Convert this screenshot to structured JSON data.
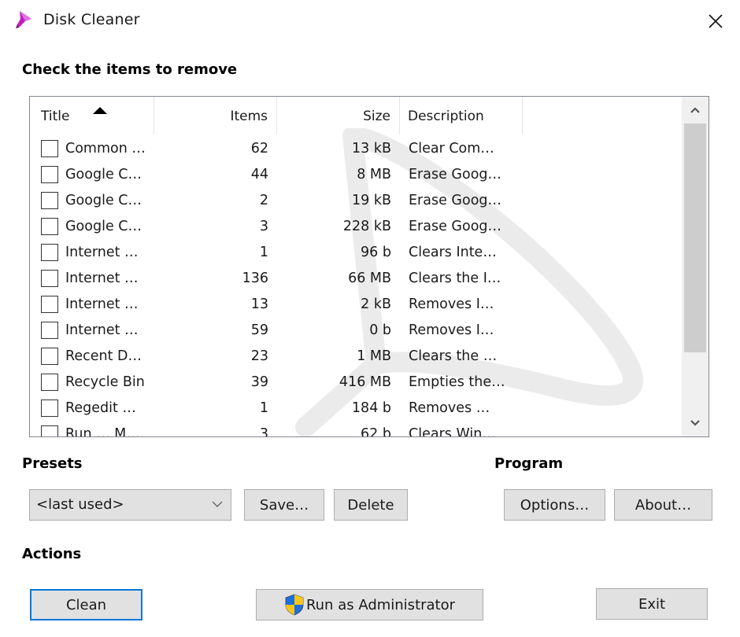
{
  "window": {
    "title": "Disk Cleaner",
    "app_icon": "funnel-icon",
    "close_icon": "close-icon"
  },
  "list_section": {
    "heading": "Check the items to remove",
    "columns": [
      {
        "label": "Title",
        "sorted": "ascending"
      },
      {
        "label": "Items"
      },
      {
        "label": "Size"
      },
      {
        "label": "Description"
      }
    ],
    "rows": [
      {
        "title": "Common …",
        "items": "62",
        "size": "13 kB",
        "description": "Clear Com…",
        "checked": false
      },
      {
        "title": "Google C…",
        "items": "44",
        "size": "8 MB",
        "description": "Erase Goog…",
        "checked": false
      },
      {
        "title": "Google C…",
        "items": "2",
        "size": "19 kB",
        "description": "Erase Goog…",
        "checked": false
      },
      {
        "title": "Google C…",
        "items": "3",
        "size": "228 kB",
        "description": "Erase Goog…",
        "checked": false
      },
      {
        "title": "Internet …",
        "items": "1",
        "size": "96 b",
        "description": "Clears Inte…",
        "checked": false
      },
      {
        "title": "Internet …",
        "items": "136",
        "size": "66 MB",
        "description": "Clears the I…",
        "checked": false
      },
      {
        "title": "Internet …",
        "items": "13",
        "size": "2 kB",
        "description": "Removes I…",
        "checked": false
      },
      {
        "title": "Internet …",
        "items": "59",
        "size": "0 b",
        "description": "Removes I…",
        "checked": false
      },
      {
        "title": "Recent D…",
        "items": "23",
        "size": "1 MB",
        "description": "Clears the …",
        "checked": false
      },
      {
        "title": "Recycle Bin",
        "items": "39",
        "size": "416 MB",
        "description": "Empties the…",
        "checked": false
      },
      {
        "title": "Regedit …",
        "items": "1",
        "size": "184 b",
        "description": "Removes …",
        "checked": false
      },
      {
        "title": "Run … M…",
        "items": "3",
        "size": "62 b",
        "description": "Clears Win…",
        "checked": false
      }
    ],
    "scroll": {
      "thumb_start_fraction": 0.0,
      "visible_fraction": 0.8
    }
  },
  "presets": {
    "heading": "Presets",
    "selected": "<last used>",
    "save_label": "Save…",
    "delete_label": "Delete"
  },
  "program": {
    "heading": "Program",
    "options_label": "Options…",
    "about_label": "About…"
  },
  "actions": {
    "heading": "Actions",
    "clean_label": "Clean",
    "run_admin_label": "Run as Administrator",
    "exit_label": "Exit"
  },
  "colors": {
    "app_icon": "#c020c0",
    "focus_border": "#0078d7",
    "shield_blue": "#1e6fd9",
    "shield_yellow": "#f7c51b"
  }
}
